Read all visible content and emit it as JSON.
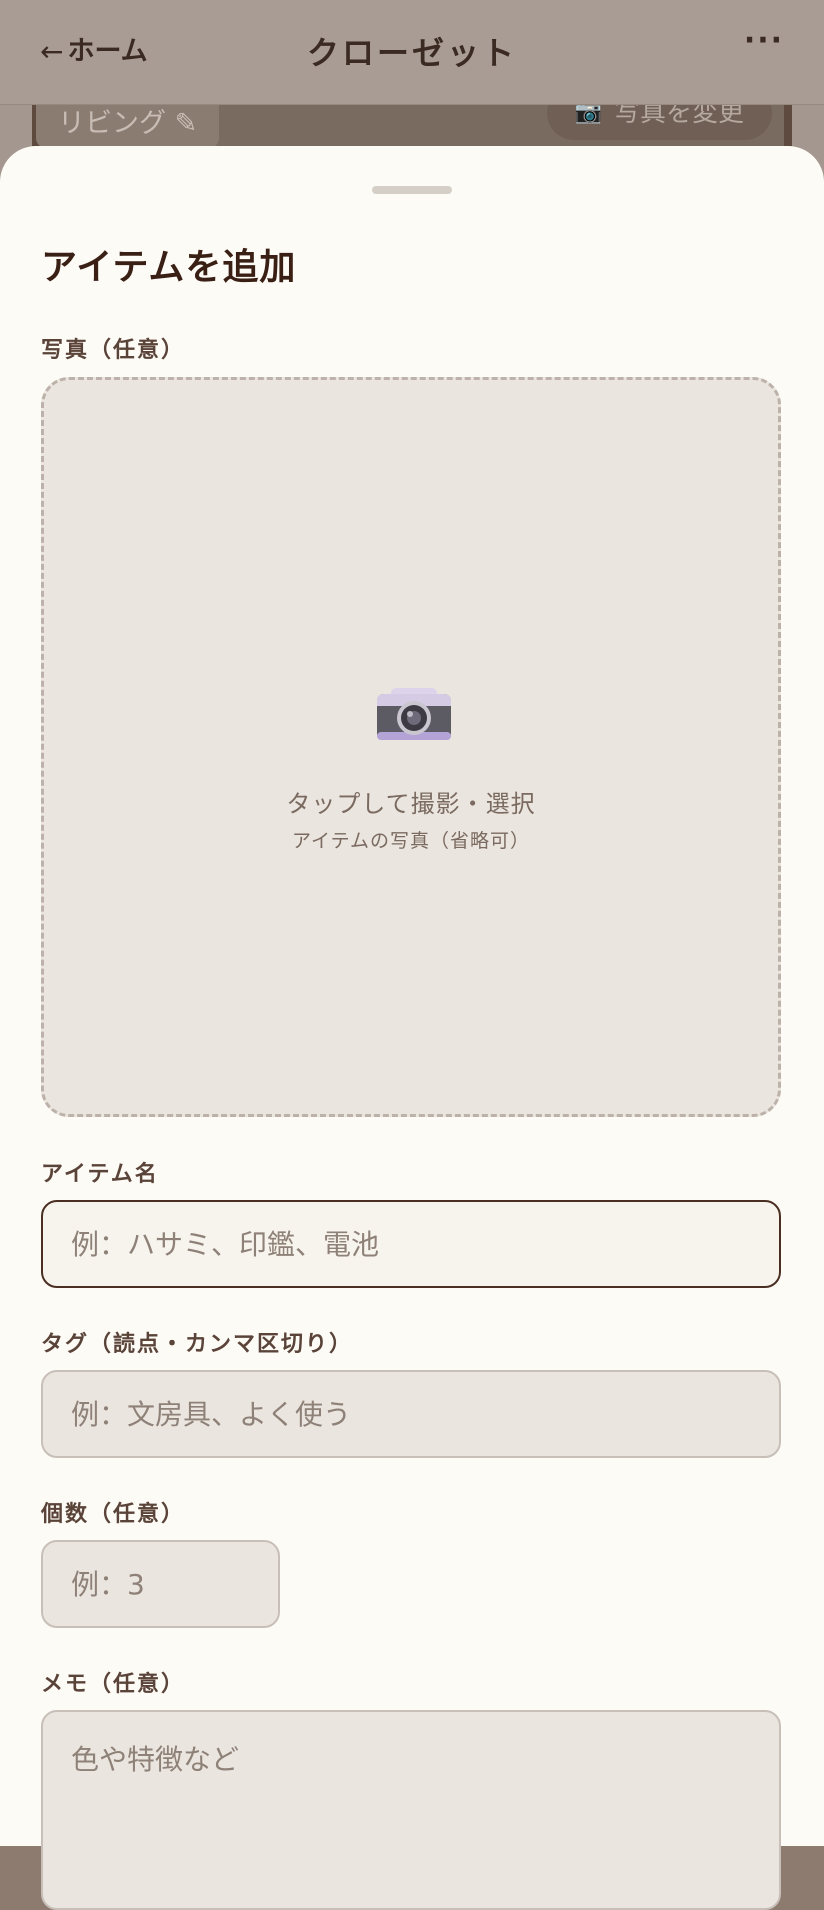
{
  "header": {
    "back_arrow": "←",
    "back_label": "ホーム",
    "title": "クローゼット",
    "more_label": "···"
  },
  "background": {
    "room_label": "リビング ✎",
    "change_photo_label": "写真を変更",
    "camera_glyph": "📷"
  },
  "sheet": {
    "title": "アイテムを追加",
    "photo": {
      "label": "写真（任意）",
      "icon": "camera-icon",
      "tap_text": "タップして撮影・選択",
      "sub_text": "アイテムの写真（省略可）"
    },
    "name": {
      "label": "アイテム名",
      "placeholder": "例：ハサミ、印鑑、電池",
      "value": ""
    },
    "tags": {
      "label": "タグ（読点・カンマ区切り）",
      "placeholder": "例：文房具、よく使う",
      "value": ""
    },
    "quantity": {
      "label": "個数（任意）",
      "placeholder": "例：3",
      "value": ""
    },
    "memo": {
      "label": "メモ（任意）",
      "placeholder": "色や特徴など",
      "value": ""
    }
  },
  "colors": {
    "sheet_background": "#fdfbf6",
    "title_text": "#3a1f14",
    "label_text": "#5a4338",
    "input_background": "#ebe5df",
    "focused_border": "#4a2e22",
    "dim_overlay": "#a3978f"
  }
}
